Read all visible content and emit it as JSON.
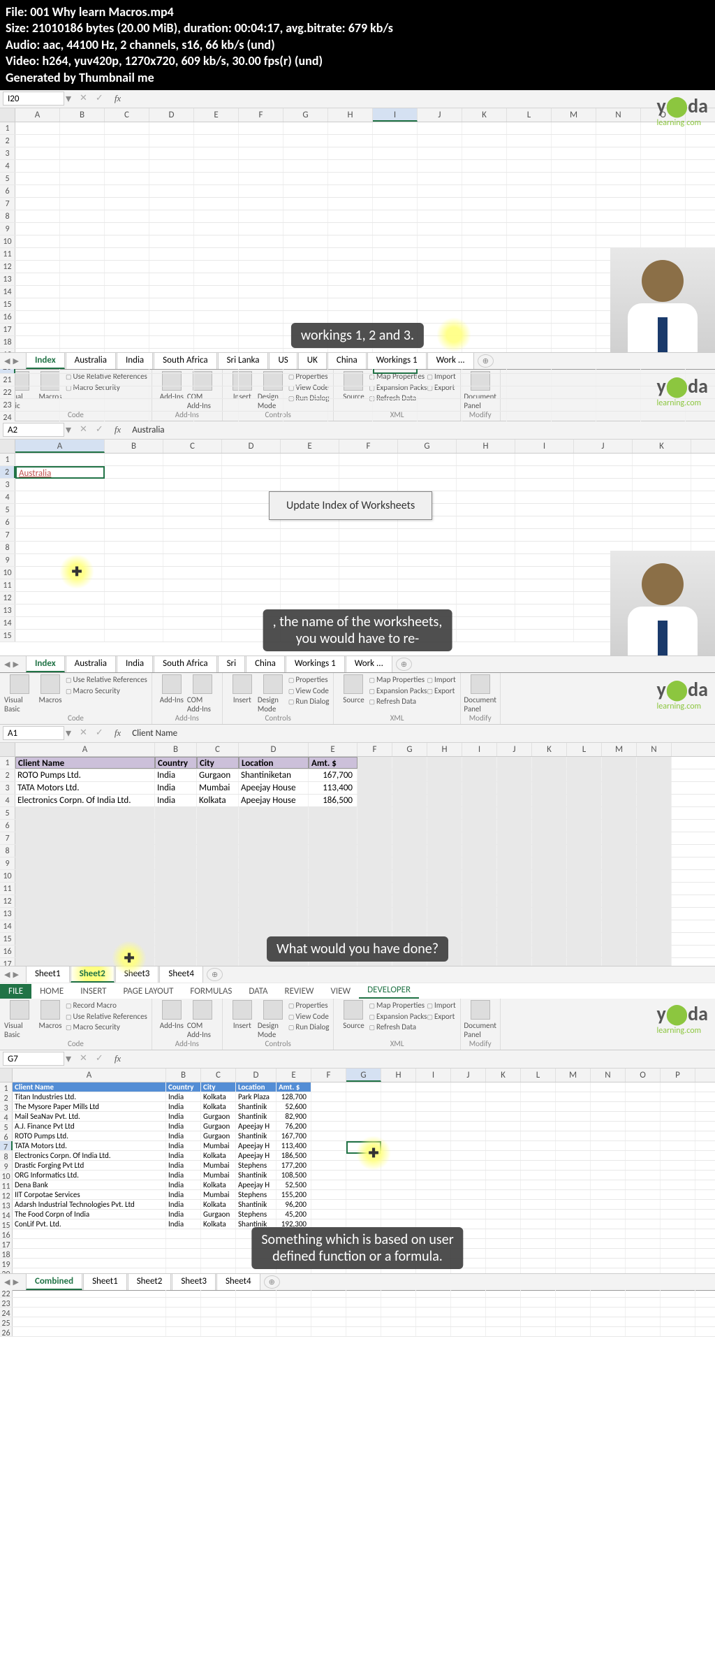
{
  "header": {
    "file": "File: 001 Why learn Macros.mp4",
    "size": "Size: 21010186 bytes (20.00 MiB), duration: 00:04:17, avg.bitrate: 679 kb/s",
    "audio": "Audio: aac, 44100 Hz, 2 channels, s16, 66 kb/s (und)",
    "video": "Video: h264, yuv420p, 1270x720, 609 kb/s, 30.00 fps(r) (und)",
    "gen": "Generated by Thumbnail me"
  },
  "logo": {
    "y": "y",
    "bulb": "⬤",
    "da": "da",
    "sub": "learning.com"
  },
  "panel1": {
    "namebox": "I20",
    "fx": "fx",
    "cols": [
      "A",
      "B",
      "C",
      "D",
      "E",
      "F",
      "G",
      "H",
      "I",
      "J",
      "K",
      "L",
      "M",
      "N",
      "O"
    ],
    "sel_col": "I",
    "rows": 24,
    "sel_row": 20,
    "tabs": [
      "Index",
      "Australia",
      "India",
      "South Africa",
      "Sri Lanka",
      "US",
      "UK",
      "China",
      "Workings 1",
      "Work ..."
    ],
    "active_tab": "Index",
    "caption": "workings 1, 2 and 3."
  },
  "ribbon": {
    "groups": {
      "code": {
        "big": [
          "Visual\nBasic",
          "Macros"
        ],
        "items": [
          "Use Relative References",
          "Macro Security"
        ],
        "label": "Code"
      },
      "addins": {
        "big": [
          "Add-Ins",
          "COM\nAdd-Ins"
        ],
        "label": "Add-Ins"
      },
      "controls": {
        "big": [
          "Insert",
          "Design\nMode"
        ],
        "items": [
          "Properties",
          "View Code",
          "Run Dialog"
        ],
        "label": "Controls"
      },
      "xml": {
        "big": [
          "Source"
        ],
        "items": [
          "Map Properties",
          "Expansion Packs",
          "Refresh Data"
        ],
        "rt": [
          "Import",
          "Export"
        ],
        "label": "XML"
      },
      "modify": {
        "big": [
          "Document\nPanel"
        ],
        "label": "Modify"
      }
    }
  },
  "panel2": {
    "namebox": "A2",
    "fx_content": "Australia",
    "cell_a2": "Australia",
    "button": "Update Index of Worksheets",
    "tabs": [
      "Index",
      "Australia",
      "India",
      "South Africa",
      "Sri",
      "China",
      "Workings 1",
      "Work ..."
    ],
    "active_tab": "Index",
    "caption": ", the name of the worksheets,\nyou would have to re-",
    "cols": [
      "A",
      "B",
      "C",
      "D",
      "E",
      "F",
      "G",
      "H",
      "I",
      "J",
      "K"
    ],
    "rows": 15
  },
  "panel3": {
    "namebox": "A1",
    "fx_content": "Client Name",
    "headers": [
      "Client Name",
      "Country",
      "City",
      "Location",
      "Amt. $"
    ],
    "rows": [
      [
        "ROTO Pumps Ltd.",
        "India",
        "Gurgaon",
        "Shantiniketan",
        "167,700"
      ],
      [
        "TATA Motors Ltd.",
        "India",
        "Mumbai",
        "Apeejay House",
        "113,400"
      ],
      [
        "Electronics Corpn. Of India Ltd.",
        "India",
        "Kolkata",
        "Apeejay House",
        "186,500"
      ]
    ],
    "tabs": [
      "Sheet1",
      "Sheet2",
      "Sheet3",
      "Sheet4"
    ],
    "active_tab": "Sheet2",
    "caption": "What would you have done?",
    "cols": [
      "A",
      "B",
      "C",
      "D",
      "E",
      "F",
      "G",
      "H",
      "I",
      "J",
      "K",
      "L",
      "M",
      "N"
    ],
    "blankrows": 20
  },
  "panel4": {
    "menutabs": [
      "FILE",
      "HOME",
      "INSERT",
      "PAGE LAYOUT",
      "FORMULAS",
      "DATA",
      "REVIEW",
      "VIEW",
      "DEVELOPER"
    ],
    "active_menu": "DEVELOPER",
    "namebox": "G7",
    "headers": [
      "Client Name",
      "Country",
      "City",
      "Location",
      "Amt. $"
    ],
    "rows": [
      [
        "Titan Industries Ltd.",
        "India",
        "Kolkata",
        "Park Plaza",
        "128,700"
      ],
      [
        "The Mysore Paper Mills Ltd",
        "India",
        "Kolkata",
        "Shantinik",
        "52,600"
      ],
      [
        "Mail SeaNav Pvt. Ltd.",
        "India",
        "Gurgaon",
        "Shantinik",
        "82,900"
      ],
      [
        "A.J. Finance Pvt Ltd",
        "India",
        "Gurgaon",
        "Apeejay H",
        "76,200"
      ],
      [
        "ROTO Pumps Ltd.",
        "India",
        "Gurgaon",
        "Shantinik",
        "167,700"
      ],
      [
        "TATA Motors Ltd.",
        "India",
        "Mumbai",
        "Apeejay H",
        "113,400"
      ],
      [
        "Electronics Corpn. Of India Ltd.",
        "India",
        "Kolkata",
        "Apeejay H",
        "186,500"
      ],
      [
        "Drastic Forging Pvt Ltd",
        "India",
        "Mumbai",
        "Stephens",
        "177,200"
      ],
      [
        "ORG Informatics Ltd.",
        "India",
        "Mumbai",
        "Shantinik",
        "108,500"
      ],
      [
        "Dena Bank",
        "India",
        "Kolkata",
        "Apeejay H",
        "52,500"
      ],
      [
        "IIT Corpotae Services",
        "India",
        "Mumbai",
        "Stephens",
        "155,200"
      ],
      [
        "Adarsh Industrial Technologies Pvt. Ltd",
        "India",
        "Kolkata",
        "Shantinik",
        "96,200"
      ],
      [
        "The Food Corpn of India",
        "India",
        "Gurgaon",
        "Stephens",
        "45,200"
      ],
      [
        "ConLif Pvt. Ltd.",
        "India",
        "Kolkata",
        "Shantinik",
        "192,300"
      ]
    ],
    "tabs": [
      "Combined",
      "Sheet1",
      "Sheet2",
      "Sheet3",
      "Sheet4"
    ],
    "active_tab": "Combined",
    "caption": "Something which is based on user\ndefined function or a formula.",
    "cols": [
      "A",
      "B",
      "C",
      "D",
      "E",
      "F",
      "G",
      "H",
      "I",
      "J",
      "K",
      "L",
      "M",
      "N",
      "O",
      "P"
    ],
    "blankrows": 10,
    "record_macro": "Record Macro"
  }
}
